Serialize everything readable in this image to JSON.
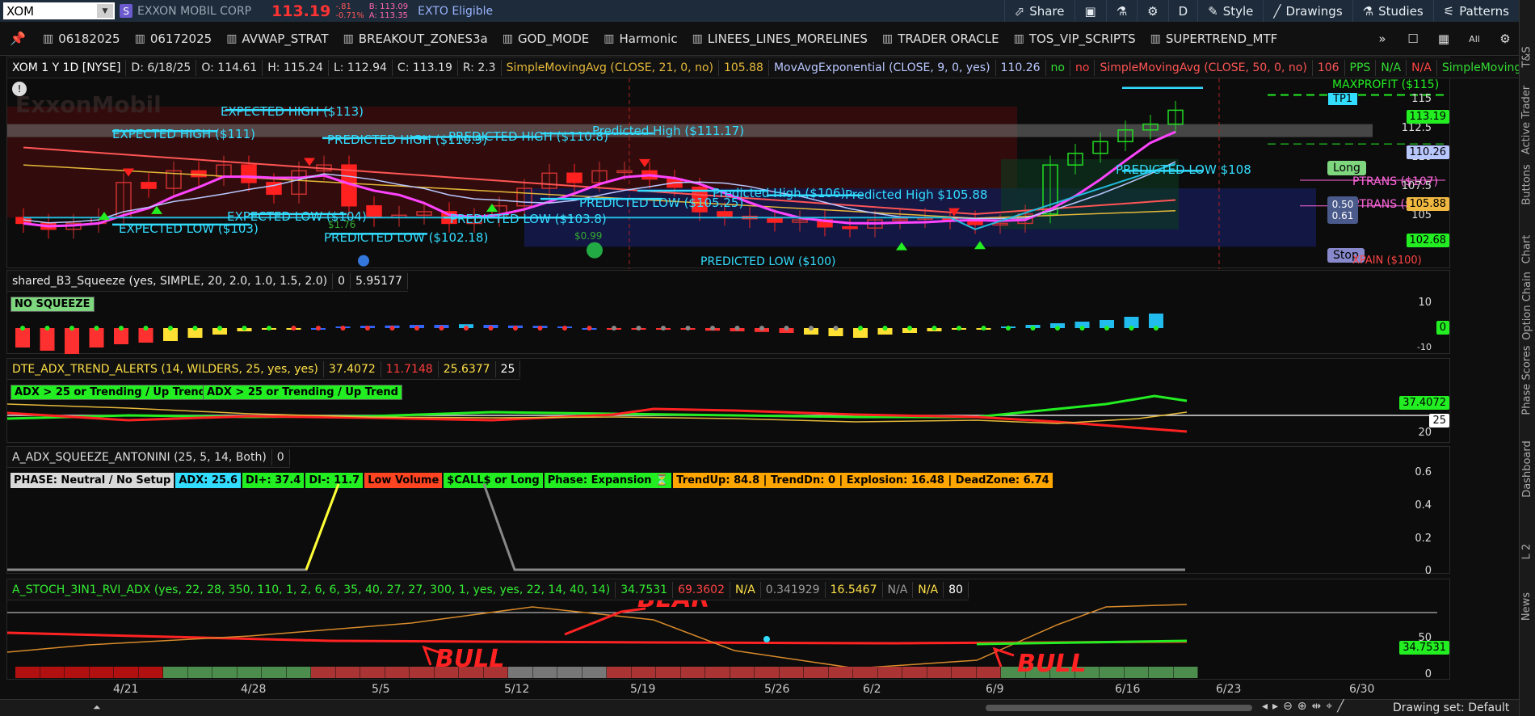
{
  "topbar": {
    "symbol": "XOM",
    "corp": "EXXON MOBIL CORP",
    "last": "113.19",
    "change": "-.81",
    "change_pct": "-0.71%",
    "bid": "B: 113.09",
    "ask": "A: 113.35",
    "exto": "EXTO Eligible",
    "buttons": {
      "share": "Share",
      "timeframe": "D",
      "style": "Style",
      "drawings": "Drawings",
      "studies": "Studies",
      "patterns": "Patterns"
    }
  },
  "tabs": [
    "06182025",
    "06172025",
    "AVWAP_STRAT",
    "BREAKOUT_ZONES3a",
    "GOD_MODE",
    "Harmonic",
    "LINEES_LINES_MORELINES",
    "TRADER ORACLE",
    "TOS_VIP_SCRIPTS",
    "SUPERTREND_MTF"
  ],
  "tabbar_right": {
    "more": "»",
    "all": "All"
  },
  "right_tabs": [
    "T&S",
    "Active Trader",
    "Buttons",
    "Chart",
    "Option Chain",
    "Phase Scores",
    "Dashboard",
    "L 2",
    "News"
  ],
  "price_panel": {
    "header": [
      {
        "text": "XOM 1 Y 1D [NYSE]",
        "color": "#ffffff"
      },
      {
        "text": "D: 6/18/25",
        "color": "#dddddd"
      },
      {
        "text": "O: 114.61",
        "color": "#dddddd"
      },
      {
        "text": "H: 115.24",
        "color": "#dddddd"
      },
      {
        "text": "L: 112.94",
        "color": "#dddddd"
      },
      {
        "text": "C: 113.19",
        "color": "#dddddd"
      },
      {
        "text": "R: 2.3",
        "color": "#dddddd"
      },
      {
        "text": "SimpleMovingAvg (CLOSE, 21, 0, no)",
        "color": "#e5b93a"
      },
      {
        "text": "105.88",
        "color": "#e5b93a"
      },
      {
        "text": "MovAvgExponential (CLOSE, 9, 0, yes)",
        "color": "#b9c7ff"
      },
      {
        "text": "110.26",
        "color": "#b9c7ff"
      },
      {
        "text": "no",
        "color": "#33dd33"
      },
      {
        "text": "no",
        "color": "#ff4444"
      },
      {
        "text": "SimpleMovingAvg (CLOSE, 50, 0, no)",
        "color": "#ff5555"
      },
      {
        "text": "106",
        "color": "#ff5555"
      },
      {
        "text": "PPS",
        "color": "#33dd33"
      },
      {
        "text": "N/A",
        "color": "#33dd33"
      },
      {
        "text": "N/A",
        "color": "#ff4444"
      },
      {
        "text": "SimpleMoving...",
        "color": "#33dd33"
      }
    ],
    "watermark": "ExxonMobil",
    "labels": {
      "expected_high_113": "EXPECTED HIGH ($113)",
      "expected_high_111": "EXPECTED HIGH ($111)",
      "predicted_high_1109": "PREDICTED HIGH ($110.9)",
      "predicted_high_1108": "PREDICTED HIGH ($110.8)",
      "predicted_high_11117": "Predicted High ($111.17)",
      "expected_low_104": "EXPECTED LOW ($104)",
      "expected_low_103": "EXPECTED LOW ($103)",
      "predicted_low_10218": "PREDICTED LOW ($102.18)",
      "predicted_low_1038": "PREDICTED LOW ($103.8)",
      "predicted_low_10525": "PREDICTED LOW ($105.25)",
      "predicted_high_106": "Predicted High ($106)",
      "predicted_high_10588": "Predicted High  $105.88",
      "predicted_low_100": "PREDICTED LOW ($100)",
      "predicted_low_108": "PREDICTED LOW   $108",
      "maxprofit": "MAXPROFIT ($115)",
      "tp1": "TP1",
      "long": "Long",
      "ptrans_107": "PTRANS ($107)",
      "ptrans_105": "PTRANS ($105)",
      "stop": "Stop",
      "xpain": "XPAIN ($100)",
      "ratio_a": "0.50",
      "ratio_b": "0.61",
      "val_176": "$1.76",
      "val_099": "$0.99"
    },
    "axis": [
      "115",
      "112.5",
      "110",
      "107.5",
      "105"
    ],
    "tags": {
      "last": "113.19",
      "ema": "110.26",
      "sma21": "105.88",
      "other": "102.68"
    }
  },
  "squeeze_panel": {
    "header": [
      "shared_B3_Squeeze (yes, SIMPLE, 20, 2.0, 1.0, 1.5, 2.0)",
      "0",
      "5.95177"
    ],
    "badge": "NO SQUEEZE",
    "axis": [
      "10",
      "-10"
    ],
    "tag": "0"
  },
  "adx_panel": {
    "header": [
      "DTE_ADX_TREND_ALERTS (14, WILDERS, 25, yes, yes)",
      "37.4072",
      "11.7148",
      "25.6377",
      "25"
    ],
    "badges": [
      "ADX > 25 or Trending / Up Trend",
      "ADX > 25 or Trending / Up Trend"
    ],
    "axis": [
      "20"
    ],
    "tags": {
      "adx": "37.4072",
      "level": "25"
    }
  },
  "antonini_panel": {
    "header": [
      "A_ADX_SQUEEZE_ANTONINI (25, 5, 14, Both)",
      "0"
    ],
    "badges": [
      {
        "text": "PHASE: Neutral / No Setup",
        "bg": "#d9d9d9",
        "fg": "#000000"
      },
      {
        "text": "ADX: 25.6",
        "bg": "#33ddff",
        "fg": "#000000"
      },
      {
        "text": "DI+: 37.4",
        "bg": "#22ee22",
        "fg": "#000000"
      },
      {
        "text": "DI-: 11.7",
        "bg": "#22ee22",
        "fg": "#000000"
      },
      {
        "text": "Low Volume",
        "bg": "#ff4422",
        "fg": "#000000"
      },
      {
        "text": "$CALL$ or Long",
        "bg": "#22ee22",
        "fg": "#000000"
      },
      {
        "text": "Phase: Expansion ⏳",
        "bg": "#22ee22",
        "fg": "#000000"
      },
      {
        "text": "TrendUp: 84.8 | TrendDn: 0 | Explosion: 16.48 | DeadZone: 6.74",
        "bg": "#ffa500",
        "fg": "#000000"
      }
    ],
    "axis": [
      "0.6",
      "0.4",
      "0.2",
      "0"
    ]
  },
  "stoch_panel": {
    "header": [
      "A_STOCH_3IN1_RVI_ADX (yes, 22, 28, 350, 110, 1, 2, 6, 6, 35, 40, 27, 27, 300, 1, yes, yes, 22, 14, 40, 14)",
      "34.7531",
      "69.3602",
      "N/A",
      "0.341929",
      "16.5467",
      "N/A",
      "N/A",
      "80"
    ],
    "annotations": {
      "bear": "BEAR",
      "bull1": "BULL",
      "bull2": "BULL"
    },
    "axis": [
      "50",
      "0"
    ],
    "tag": "34.7531"
  },
  "xaxis": [
    "4/21",
    "4/28",
    "5/5",
    "5/12",
    "5/19",
    "5/26",
    "6/2",
    "6/9",
    "6/16",
    "6/23",
    "6/30"
  ],
  "bottombar": {
    "drawing_set": "Drawing set: Default"
  },
  "chart_data": {
    "type": "candlestick",
    "symbol": "XOM",
    "period": "1 Y 1D",
    "categories": [
      "4/21",
      "4/28",
      "5/5",
      "5/12",
      "5/19",
      "5/26",
      "6/2",
      "6/9",
      "6/16",
      "6/23",
      "6/30"
    ],
    "last_bar": {
      "date": "6/18/25",
      "open": 114.61,
      "high": 115.24,
      "low": 112.94,
      "close": 113.19
    },
    "closes": [
      103.5,
      103,
      103.5,
      104,
      107,
      106.5,
      108,
      107.5,
      108.5,
      107,
      106,
      108,
      108.5,
      105,
      104,
      104.2,
      104.5,
      103.5,
      104,
      105,
      106.5,
      107.8,
      107,
      108,
      108,
      107.3,
      106.6,
      104.5,
      104.1,
      103.9,
      103.6,
      103.8,
      103.2,
      103.1,
      103.8,
      103.9,
      104,
      103.8,
      103.4,
      103.5,
      104.3,
      108.5,
      109.5,
      110.5,
      111.5,
      112,
      113.19
    ],
    "ylim": [
      100,
      115.5
    ],
    "indicators": {
      "sma21": 105.88,
      "ema9": 110.26,
      "sma50": 106
    }
  }
}
